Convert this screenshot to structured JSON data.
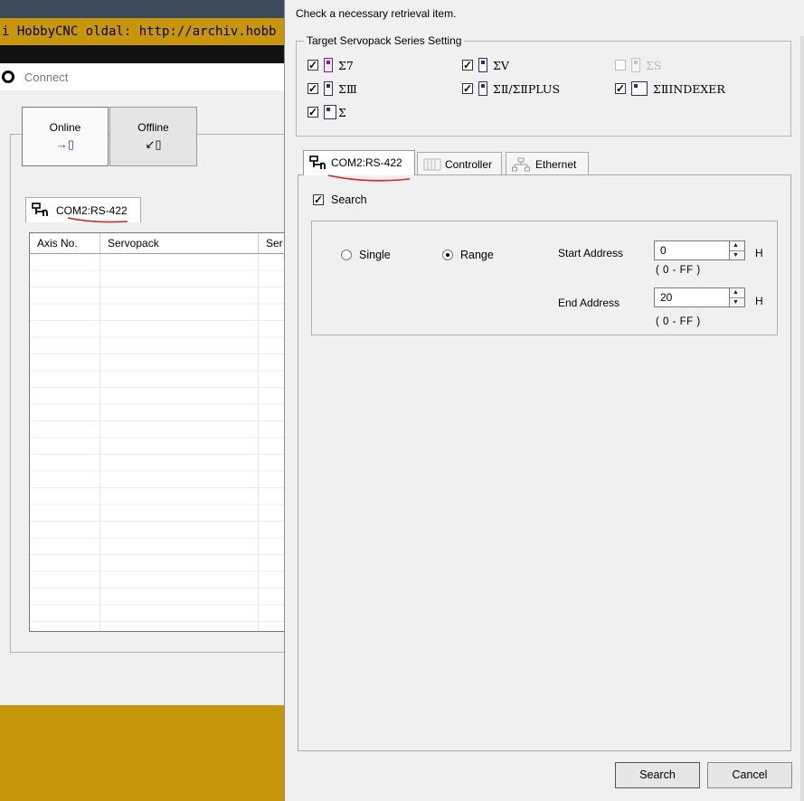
{
  "background": {
    "banner_text": "i HobbyCNC oldal: http://archiv.hobb"
  },
  "connect": {
    "title": "Connect",
    "online_label": "Online",
    "online_icon": "→▯",
    "offline_label": "Offline",
    "offline_icon": "↙▯",
    "tab_label": "COM2:RS-422",
    "tab_icon": "⚯",
    "columns": [
      "Axis No.",
      "Servopack",
      "Ser"
    ]
  },
  "dialog": {
    "hint": "Check a necessary retrieval item.",
    "group_title": "Target Servopack Series Setting",
    "series": [
      {
        "label": "Σ7",
        "checked": true
      },
      {
        "label": "ΣV",
        "checked": true
      },
      {
        "label": "ΣS",
        "checked": false
      },
      {
        "label": "ΣⅢ",
        "checked": true
      },
      {
        "label": "ΣⅡ/ΣⅡPLUS",
        "checked": true
      },
      {
        "label": "ΣⅡINDEXER",
        "checked": true
      },
      {
        "label": "Σ",
        "checked": true
      }
    ],
    "tabs": {
      "com2": "COM2:RS-422",
      "controller": "Controller",
      "ethernet": "Ethernet"
    },
    "search_check_label": "Search",
    "search_checked": true,
    "radio_single": "Single",
    "radio_range": "Range",
    "start_address_label": "Start Address",
    "start_address_value": "0",
    "start_address_unit": "H",
    "start_address_range": "( 0 - FF )",
    "end_address_label": "End Address",
    "end_address_value": "20",
    "end_address_unit": "H",
    "end_address_range": "( 0 - FF )",
    "search_button": "Search",
    "cancel_button": "Cancel"
  },
  "colors": {
    "background_gold": "#c8960a",
    "annotation_red": "#e02020"
  }
}
